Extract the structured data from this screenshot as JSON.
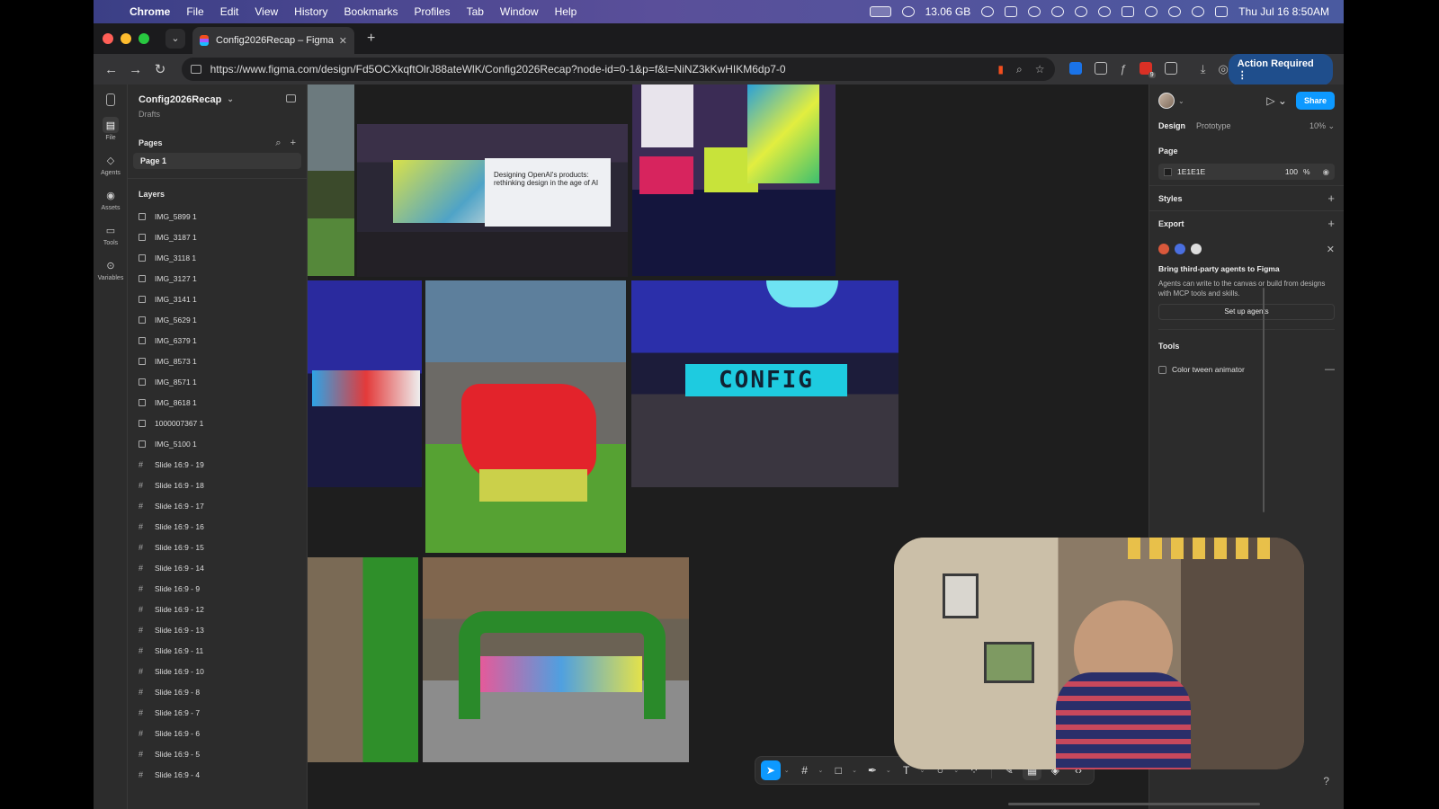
{
  "menubar": {
    "app": "Chrome",
    "items": [
      "File",
      "Edit",
      "View",
      "History",
      "Bookmarks",
      "Profiles",
      "Tab",
      "Window",
      "Help"
    ],
    "memory": "13.06 GB",
    "datetime": "Thu Jul 16  8:50AM"
  },
  "browser": {
    "tab_title": "Config2026Recap – Figma",
    "url": "https://www.figma.com/design/Fd5OCXkqftOlrJ88ateWlK/Config2026Recap?node-id=0-1&p=f&t=NiNZ3kKwHIKM6dp7-0",
    "action_required": "Action Required",
    "extension_badge": "9"
  },
  "rail": {
    "items": [
      {
        "label": "File",
        "icon": "file-icon"
      },
      {
        "label": "Agents",
        "icon": "agents-icon"
      },
      {
        "label": "Assets",
        "icon": "assets-icon"
      },
      {
        "label": "Tools",
        "icon": "tools-icon"
      },
      {
        "label": "Variables",
        "icon": "variables-icon"
      }
    ]
  },
  "left_panel": {
    "file_name": "Config2026Recap",
    "location": "Drafts",
    "pages_heading": "Pages",
    "current_page": "Page 1",
    "layers_heading": "Layers",
    "layers": [
      {
        "name": "IMG_5899 1",
        "kind": "image"
      },
      {
        "name": "IMG_3187 1",
        "kind": "image"
      },
      {
        "name": "IMG_3118 1",
        "kind": "image"
      },
      {
        "name": "IMG_3127 1",
        "kind": "image"
      },
      {
        "name": "IMG_3141 1",
        "kind": "image"
      },
      {
        "name": "IMG_5629 1",
        "kind": "image"
      },
      {
        "name": "IMG_6379 1",
        "kind": "image"
      },
      {
        "name": "IMG_8573 1",
        "kind": "image"
      },
      {
        "name": "IMG_8571 1",
        "kind": "image"
      },
      {
        "name": "IMG_8618 1",
        "kind": "image"
      },
      {
        "name": "1000007367 1",
        "kind": "image"
      },
      {
        "name": "IMG_5100 1",
        "kind": "image"
      },
      {
        "name": "Slide 16:9 - 19",
        "kind": "frame"
      },
      {
        "name": "Slide 16:9 - 18",
        "kind": "frame"
      },
      {
        "name": "Slide 16:9 - 17",
        "kind": "frame"
      },
      {
        "name": "Slide 16:9 - 16",
        "kind": "frame"
      },
      {
        "name": "Slide 16:9 - 15",
        "kind": "frame"
      },
      {
        "name": "Slide 16:9 - 14",
        "kind": "frame"
      },
      {
        "name": "Slide 16:9 - 9",
        "kind": "frame"
      },
      {
        "name": "Slide 16:9 - 12",
        "kind": "frame"
      },
      {
        "name": "Slide 16:9 - 13",
        "kind": "frame"
      },
      {
        "name": "Slide 16:9 - 11",
        "kind": "frame"
      },
      {
        "name": "Slide 16:9 - 10",
        "kind": "frame"
      },
      {
        "name": "Slide 16:9 - 8",
        "kind": "frame"
      },
      {
        "name": "Slide 16:9 - 7",
        "kind": "frame"
      },
      {
        "name": "Slide 16:9 - 6",
        "kind": "frame"
      },
      {
        "name": "Slide 16:9 - 5",
        "kind": "frame"
      },
      {
        "name": "Slide 16:9 - 4",
        "kind": "frame"
      }
    ]
  },
  "canvas": {
    "slide_text": "Designing OpenAI's products: rethinking design in the age of AI",
    "stage_sign": "CONFIG"
  },
  "right_panel": {
    "share": "Share",
    "tabs": [
      "Design",
      "Prototype"
    ],
    "zoom": "10%",
    "page_heading": "Page",
    "page_fill_hex": "1E1E1E",
    "page_fill_opacity": "100",
    "percent_sign": "%",
    "styles_heading": "Styles",
    "export_heading": "Export",
    "agents_title": "Bring third-party agents to Figma",
    "agents_desc": "Agents can write to the canvas or build from designs with MCP tools and skills.",
    "setup_button": "Set up agents",
    "tools_heading": "Tools",
    "tool_item": "Color tween animator",
    "help": "?"
  },
  "colors": {
    "accent": "#0d99ff",
    "canvas_bg": "#1E1E1E"
  }
}
